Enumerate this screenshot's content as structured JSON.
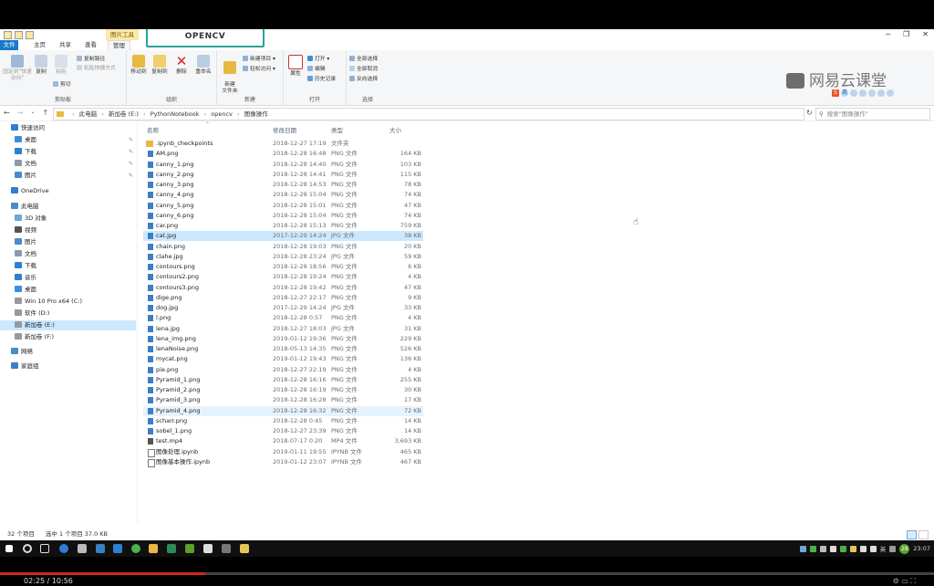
{
  "window": {
    "context_tab": "图片工具",
    "buttons": [
      "─",
      "❐",
      "✕"
    ]
  },
  "ribbon_tabs": [
    {
      "label": "文件"
    },
    {
      "label": "主页"
    },
    {
      "label": "共享"
    },
    {
      "label": "查看"
    },
    {
      "label": "管理"
    }
  ],
  "popup": "OPENCV",
  "watermark": "网易云课堂",
  "ribbon": {
    "clipboard": {
      "group": "剪贴板",
      "pin": "固定到\"快速访问\"",
      "copy": "复制",
      "paste": "粘贴",
      "copy_path": "复制路径",
      "paste_shortcut": "粘贴快捷方式",
      "cut": "剪切"
    },
    "organize": {
      "group": "组织",
      "move_to": "移动到",
      "copy_to": "复制到",
      "delete": "删除",
      "rename": "重命名"
    },
    "new": {
      "group": "新建",
      "new_item": "新建项目 ▾",
      "easy_access": "轻松访问 ▾",
      "new_folder": "新建\n文件夹"
    },
    "open": {
      "group": "打开",
      "properties": "属性",
      "open": "打开 ▾",
      "edit": "编辑",
      "history": "历史记录"
    },
    "select": {
      "group": "选择",
      "select_all": "全部选择",
      "select_none": "全部取消",
      "invert": "反向选择"
    }
  },
  "address": {
    "crumbs": [
      "此电脑",
      "新加卷 (E:)",
      "PythonNotebook",
      "opencv",
      "图像操作"
    ],
    "search_placeholder": "搜索\"图像操作\""
  },
  "sidebar": {
    "items": [
      {
        "label": "快速访问",
        "icon": "star-icon",
        "color": "#2d7fd3",
        "level": 0
      },
      {
        "label": "桌面",
        "icon": "desktop-icon",
        "color": "#3b8fd9",
        "level": 1,
        "pinned": true
      },
      {
        "label": "下载",
        "icon": "download-icon",
        "color": "#2d7fd3",
        "level": 1,
        "pinned": true
      },
      {
        "label": "文档",
        "icon": "document-icon",
        "color": "#8a9bb0",
        "level": 1,
        "pinned": true
      },
      {
        "label": "图片",
        "icon": "picture-icon",
        "color": "#4a8bc9",
        "level": 1,
        "pinned": true
      },
      {
        "label": "OneDrive",
        "icon": "cloud-icon",
        "color": "#2d7fd3",
        "level": 0
      },
      {
        "label": "此电脑",
        "icon": "computer-icon",
        "color": "#4a8bc9",
        "level": 0
      },
      {
        "label": "3D 对象",
        "icon": "cube-icon",
        "color": "#6fa5d8",
        "level": 1
      },
      {
        "label": "视频",
        "icon": "video-icon",
        "color": "#555",
        "level": 1
      },
      {
        "label": "图片",
        "icon": "picture-icon",
        "color": "#4a8bc9",
        "level": 1
      },
      {
        "label": "文档",
        "icon": "document-icon",
        "color": "#8a9bb0",
        "level": 1
      },
      {
        "label": "下载",
        "icon": "download-icon",
        "color": "#2d7fd3",
        "level": 1
      },
      {
        "label": "音乐",
        "icon": "music-icon",
        "color": "#2d7fd3",
        "level": 1
      },
      {
        "label": "桌面",
        "icon": "desktop-icon",
        "color": "#3b8fd9",
        "level": 1
      },
      {
        "label": "Win 10 Pro x64 (C:)",
        "icon": "drive-icon",
        "color": "#999",
        "level": 1
      },
      {
        "label": "软件 (D:)",
        "icon": "drive-icon",
        "color": "#999",
        "level": 1
      },
      {
        "label": "新加卷 (E:)",
        "icon": "drive-icon",
        "color": "#999",
        "level": 1,
        "selected": true
      },
      {
        "label": "新加卷 (F:)",
        "icon": "drive-icon",
        "color": "#999",
        "level": 1
      },
      {
        "label": "网络",
        "icon": "network-icon",
        "color": "#4a8bc9",
        "level": 0
      },
      {
        "label": "家庭组",
        "icon": "homegroup-icon",
        "color": "#3a7fc2",
        "level": 0
      }
    ]
  },
  "columns": {
    "name": "名称",
    "date": "修改日期",
    "type": "类型",
    "size": "大小"
  },
  "files": [
    {
      "name": ".ipynb_checkpoints",
      "date": "2018-12-27 17:19",
      "type": "文件夹",
      "size": "",
      "kind": "folder"
    },
    {
      "name": "AM.png",
      "date": "2018-12-28 16:48",
      "type": "PNG 文件",
      "size": "164 KB",
      "kind": "image"
    },
    {
      "name": "canny_1.png",
      "date": "2018-12-28 14:40",
      "type": "PNG 文件",
      "size": "103 KB",
      "kind": "image"
    },
    {
      "name": "canny_2.png",
      "date": "2018-12-28 14:41",
      "type": "PNG 文件",
      "size": "115 KB",
      "kind": "image"
    },
    {
      "name": "canny_3.png",
      "date": "2018-12-28 14:53",
      "type": "PNG 文件",
      "size": "78 KB",
      "kind": "image"
    },
    {
      "name": "canny_4.png",
      "date": "2018-12-28 15:04",
      "type": "PNG 文件",
      "size": "74 KB",
      "kind": "image"
    },
    {
      "name": "canny_5.png",
      "date": "2018-12-28 15:01",
      "type": "PNG 文件",
      "size": "47 KB",
      "kind": "image"
    },
    {
      "name": "canny_6.png",
      "date": "2018-12-28 15:04",
      "type": "PNG 文件",
      "size": "74 KB",
      "kind": "image"
    },
    {
      "name": "car.png",
      "date": "2018-12-28 15:13",
      "type": "PNG 文件",
      "size": "759 KB",
      "kind": "image"
    },
    {
      "name": "cat.jpg",
      "date": "2017-12-29 14:24",
      "type": "JPG 文件",
      "size": "38 KB",
      "kind": "image",
      "selected": true
    },
    {
      "name": "chain.png",
      "date": "2018-12-28 19:03",
      "type": "PNG 文件",
      "size": "20 KB",
      "kind": "image"
    },
    {
      "name": "clahe.jpg",
      "date": "2018-12-28 23:24",
      "type": "JPG 文件",
      "size": "59 KB",
      "kind": "image"
    },
    {
      "name": "contours.png",
      "date": "2018-12-28 18:56",
      "type": "PNG 文件",
      "size": "6 KB",
      "kind": "image"
    },
    {
      "name": "contours2.png",
      "date": "2018-12-28 19:24",
      "type": "PNG 文件",
      "size": "4 KB",
      "kind": "image"
    },
    {
      "name": "contours3.png",
      "date": "2018-12-28 19:42",
      "type": "PNG 文件",
      "size": "47 KB",
      "kind": "image"
    },
    {
      "name": "dige.png",
      "date": "2018-12-27 22:17",
      "type": "PNG 文件",
      "size": "9 KB",
      "kind": "image"
    },
    {
      "name": "dog.jpg",
      "date": "2017-12-29 14:24",
      "type": "JPG 文件",
      "size": "33 KB",
      "kind": "image"
    },
    {
      "name": "l.png",
      "date": "2018-12-28 0:57",
      "type": "PNG 文件",
      "size": "4 KB",
      "kind": "image"
    },
    {
      "name": "lena.jpg",
      "date": "2018-12-27 18:03",
      "type": "JPG 文件",
      "size": "31 KB",
      "kind": "image"
    },
    {
      "name": "lena_img.png",
      "date": "2019-01-12 19:36",
      "type": "PNG 文件",
      "size": "229 KB",
      "kind": "image"
    },
    {
      "name": "lenaNoise.png",
      "date": "2018-05-13 14:35",
      "type": "PNG 文件",
      "size": "526 KB",
      "kind": "image"
    },
    {
      "name": "mycat.png",
      "date": "2019-01-12 19:43",
      "type": "PNG 文件",
      "size": "136 KB",
      "kind": "image"
    },
    {
      "name": "pie.png",
      "date": "2018-12-27 22:19",
      "type": "PNG 文件",
      "size": "4 KB",
      "kind": "image"
    },
    {
      "name": "Pyramid_1.png",
      "date": "2018-12-28 16:16",
      "type": "PNG 文件",
      "size": "255 KB",
      "kind": "image"
    },
    {
      "name": "Pyramid_2.png",
      "date": "2018-12-28 16:19",
      "type": "PNG 文件",
      "size": "30 KB",
      "kind": "image"
    },
    {
      "name": "Pyramid_3.png",
      "date": "2018-12-28 16:28",
      "type": "PNG 文件",
      "size": "17 KB",
      "kind": "image"
    },
    {
      "name": "Pyramid_4.png",
      "date": "2018-12-28 16:32",
      "type": "PNG 文件",
      "size": "72 KB",
      "kind": "image",
      "hover": true
    },
    {
      "name": "scharr.png",
      "date": "2018-12-28 0:45",
      "type": "PNG 文件",
      "size": "14 KB",
      "kind": "image"
    },
    {
      "name": "sobel_1.png",
      "date": "2018-12-27 23:39",
      "type": "PNG 文件",
      "size": "14 KB",
      "kind": "image"
    },
    {
      "name": "test.mp4",
      "date": "2018-07-17 0:20",
      "type": "MP4 文件",
      "size": "3,693 KB",
      "kind": "video"
    },
    {
      "name": "图像处理.ipynb",
      "date": "2019-01-11 19:55",
      "type": "IPYNB 文件",
      "size": "465 KB",
      "kind": "doc"
    },
    {
      "name": "图像基本操作.ipynb",
      "date": "2019-01-12 23:07",
      "type": "IPYNB 文件",
      "size": "467 KB",
      "kind": "doc"
    }
  ],
  "status": {
    "count": "32 个项目",
    "selection": "选中 1 个项目  37.0 KB"
  },
  "taskbar": {
    "clock": "23:07",
    "badge": "28",
    "ime": "英"
  },
  "video": {
    "time": "02:25 / 10:56",
    "progress": 0.22
  }
}
